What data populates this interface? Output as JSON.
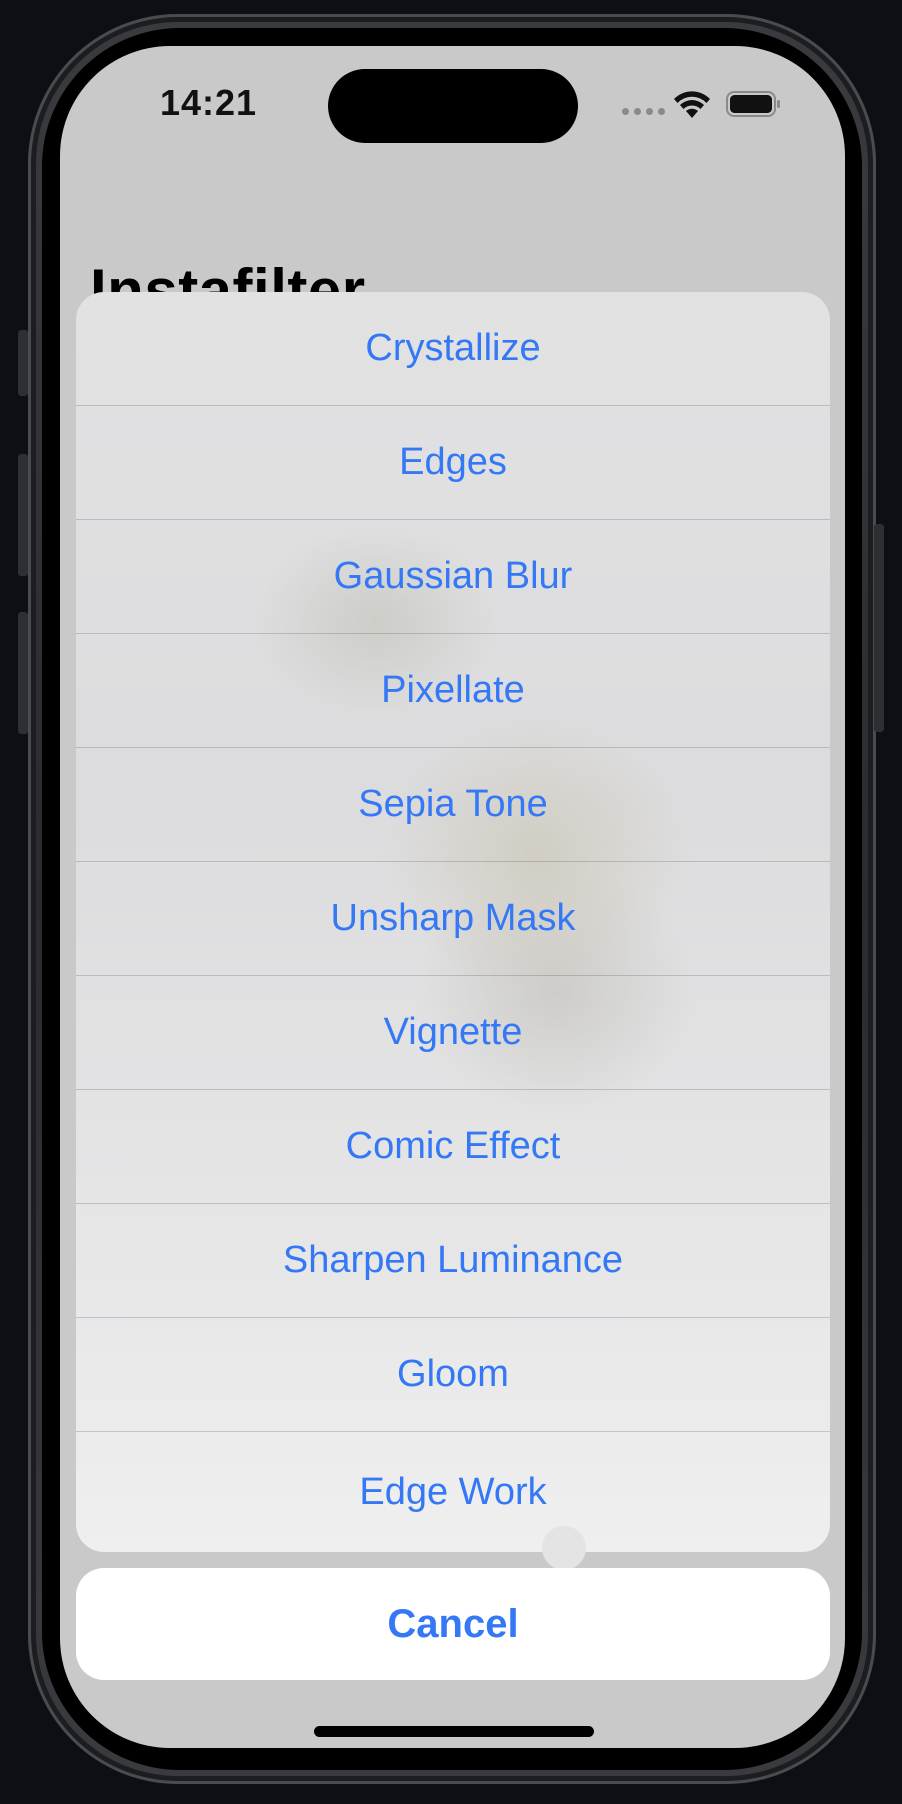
{
  "status_bar": {
    "time": "14:21",
    "icons": [
      "cellular-signal-icon",
      "wifi-icon",
      "battery-icon"
    ]
  },
  "app": {
    "title": "Instafilter"
  },
  "action_sheet": {
    "options": [
      {
        "label": "Crystallize"
      },
      {
        "label": "Edges"
      },
      {
        "label": "Gaussian Blur"
      },
      {
        "label": "Pixellate"
      },
      {
        "label": "Sepia Tone"
      },
      {
        "label": "Unsharp Mask"
      },
      {
        "label": "Vignette"
      },
      {
        "label": "Comic Effect"
      },
      {
        "label": "Sharpen Luminance"
      },
      {
        "label": "Gloom"
      },
      {
        "label": "Edge Work"
      }
    ],
    "cancel_label": "Cancel"
  },
  "colors": {
    "accent": "#3478f6",
    "sheet_background": "#e2e2e3",
    "cancel_background": "#ffffff",
    "screen_background": "#c9c9c9"
  }
}
